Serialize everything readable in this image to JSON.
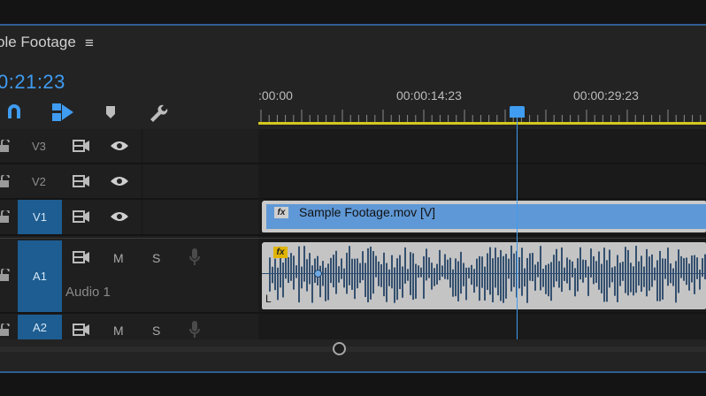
{
  "sequence": {
    "title": "ole Footage",
    "menu_glyph": "≡",
    "timecode": "0:21:23"
  },
  "ruler": {
    "labels": [
      ":00:00",
      "00:00:14:23",
      "00:00:29:23"
    ]
  },
  "tools": [
    "snap-magnet-icon",
    "linked-selection-icon",
    "add-marker-icon",
    "timeline-settings-wrench-icon"
  ],
  "tracks": {
    "v3": {
      "label": "V3"
    },
    "v2": {
      "label": "V2"
    },
    "v1": {
      "label": "V1"
    },
    "a1": {
      "label": "A1",
      "name": "Audio 1",
      "mute": "M",
      "solo": "S"
    },
    "a2": {
      "label": "A2",
      "mute": "M",
      "solo": "S"
    }
  },
  "clips": {
    "video": {
      "name": "Sample Footage.mov [V]",
      "fx": "fx"
    },
    "audio": {
      "fx": "fx",
      "channel": "L"
    }
  },
  "colors": {
    "accent": "#3f9cf0",
    "target_track": "#1d5d91",
    "video_clip": "#5f98d6",
    "audio_wave": "#34506f",
    "work_area": "#d4c81e"
  }
}
